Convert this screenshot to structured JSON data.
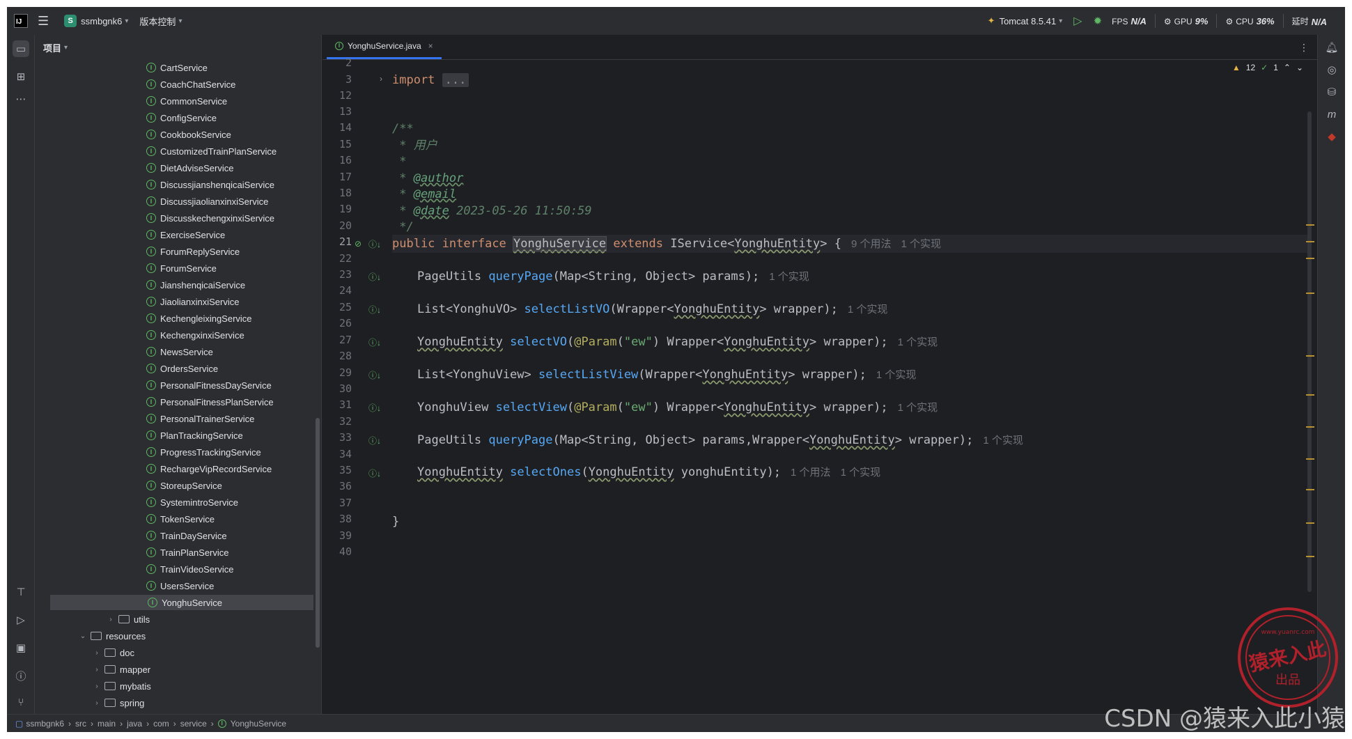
{
  "titlebar": {
    "project_initial": "S",
    "project_name": "ssmbgnk6",
    "vcs_label": "版本控制",
    "run_config": "Tomcat 8.5.41",
    "fps_label": "FPS",
    "fps_value": "N/A",
    "gpu_label": "GPU",
    "gpu_value": "9%",
    "cpu_label": "CPU",
    "cpu_value": "36%",
    "time_label": "延时",
    "time_value": "N/A"
  },
  "project_panel": {
    "title": "项目",
    "items": [
      "CartService",
      "CoachChatService",
      "CommonService",
      "ConfigService",
      "CookbookService",
      "CustomizedTrainPlanService",
      "DietAdviseService",
      "DiscussjianshenqicaiService",
      "DiscussjiaolianxinxiService",
      "DiscusskechengxinxiService",
      "ExerciseService",
      "ForumReplyService",
      "ForumService",
      "JianshenqicaiService",
      "JiaolianxinxiService",
      "KechengleixingService",
      "KechengxinxiService",
      "NewsService",
      "OrdersService",
      "PersonalFitnessDayService",
      "PersonalFitnessPlanService",
      "PersonalTrainerService",
      "PlanTrackingService",
      "ProgressTrackingService",
      "RechargeVipRecordService",
      "StoreupService",
      "SystemintroService",
      "TokenService",
      "TrainDayService",
      "TrainPlanService",
      "TrainVideoService",
      "UsersService",
      "YonghuService"
    ],
    "selected": "YonghuService",
    "folders": {
      "utils": "utils",
      "resources": "resources",
      "doc": "doc",
      "mapper": "mapper",
      "mybatis": "mybatis",
      "spring": "spring"
    }
  },
  "editor": {
    "tab_label": "YonghuService.java",
    "inspections": {
      "warnings": "12",
      "ok": "1"
    },
    "line_numbers": [
      "2",
      "3",
      "12",
      "13",
      "14",
      "15",
      "16",
      "17",
      "18",
      "19",
      "20",
      "21",
      "22",
      "23",
      "24",
      "25",
      "26",
      "27",
      "28",
      "29",
      "30",
      "31",
      "32",
      "33",
      "34",
      "35",
      "36",
      "37",
      "38",
      "39",
      "40"
    ],
    "code": {
      "import_kw": "import",
      "import_fold": "...",
      "doc_open": "/**",
      "doc_user": " * 用户",
      "doc_star": " *",
      "doc_star2": " * ",
      "doc_author": "@author",
      "doc_email": "@email",
      "doc_date": "@date",
      "doc_date_value": " 2023-05-26 11:50:59",
      "doc_close": " */",
      "kw_public": "public",
      "kw_interface": "interface",
      "kw_extends": "extends",
      "class_name": "YonghuService",
      "super_type": "IService<",
      "entity": "YonghuEntity",
      "vo": "YonghuVO",
      "view": "YonghuView",
      "brace_open": "> {",
      "brace_close": "}",
      "usages_9": "9 个用法",
      "impl_1": "1 个实现",
      "usage_1": "1 个用法",
      "l23_a": "PageUtils ",
      "m_queryPage": "queryPage",
      "l23_b": "(Map<String, Object> params);",
      "l25_a": "List<YonghuVO> ",
      "m_selectListVO": "selectListVO",
      "l25_b": "(Wrapper<",
      "l25_c": "> wrapper);",
      "m_selectVO": "selectVO",
      "l27_a": "(",
      "ann_param": "@Param",
      "str_ew": "\"ew\"",
      "l27_b": ") Wrapper<",
      "l27_c": "> wrapper);",
      "l29_a": "List<YonghuView> ",
      "m_selectListView": "selectListView",
      "l29_b": "(Wrapper<",
      "l29_c": "> wrapper);",
      "l31_a": "YonghuView ",
      "m_selectView": "selectView",
      "l33_b": "(Map<String, Object> params,Wrapper<",
      "l33_c": "> wrapper);",
      "m_selectOnes": "selectOnes",
      "l35_a": "(",
      "l35_b": " yonghuEntity);",
      "space": " "
    }
  },
  "statusbar": {
    "crumbs": [
      "ssmbgnk6",
      "src",
      "main",
      "java",
      "com",
      "service",
      "YonghuService"
    ]
  },
  "watermark": "CSDN @猿来入此小猿",
  "stamp_text": "猿来入此",
  "stamp_sub": "出品",
  "stamp_url": "www.yuanrc.com",
  "colors": {
    "background": "#1e1f22",
    "panel": "#2b2d30",
    "keyword": "#cf8e6d",
    "method": "#56a8f5",
    "string": "#6aab73",
    "annotation": "#b3ae60",
    "accent": "#3574f0"
  }
}
